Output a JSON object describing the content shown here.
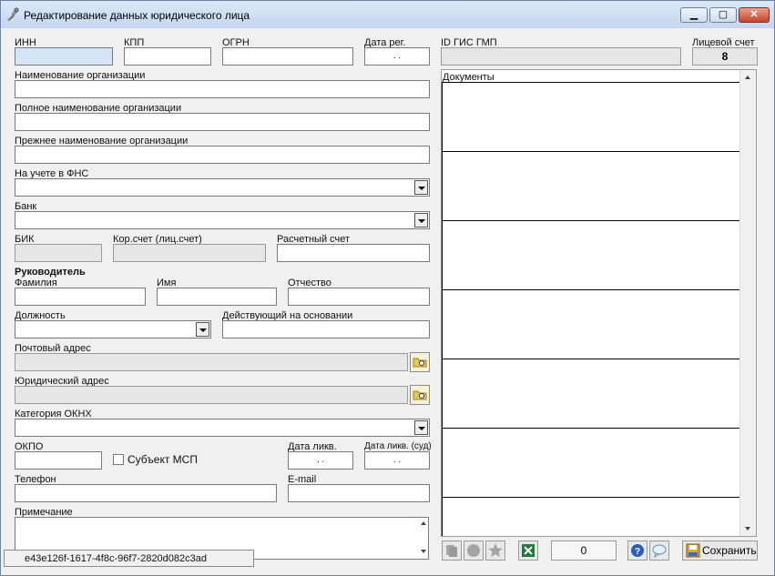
{
  "window": {
    "title": "Редактирование данных юридического лица"
  },
  "fields": {
    "inn": "ИНН",
    "kpp": "КПП",
    "ogrn": "ОГРН",
    "date_reg": "Дата рег.",
    "date_placeholder": ". .",
    "id_gis": "ID ГИС ГМП",
    "account_label": "Лицевой счет",
    "account_value": "8",
    "org_name": "Наименование организации",
    "full_name": "Полное наименование организации",
    "prev_name": "Прежнее наименование организации",
    "fns": "На учете в ФНС",
    "bank": "Банк",
    "bik": "БИК",
    "korr": "Кор.счет (лиц.счет)",
    "rs": "Расчетный счет",
    "head": "Руководитель",
    "surname": "Фамилия",
    "first": "Имя",
    "patronymic": "Отчество",
    "position": "Должность",
    "basis": "Действующий на основании",
    "post_addr": "Почтовый адрес",
    "legal_addr": "Юридический адрес",
    "okfs": "Категория ОКНХ",
    "okpo": "ОКПО",
    "msp": "Субъект МСП",
    "date_liq": "Дата ликв.",
    "date_liq_court": "Дата ликв. (суд)",
    "phone": "Телефон",
    "email": "E-mail",
    "notes": "Примечание"
  },
  "documents": {
    "header": "Документы"
  },
  "toolbar": {
    "counter": "0",
    "save": "Сохранить"
  },
  "status": {
    "guid": "e43e126f-1617-4f8c-96f7-2820d082c3ad"
  }
}
